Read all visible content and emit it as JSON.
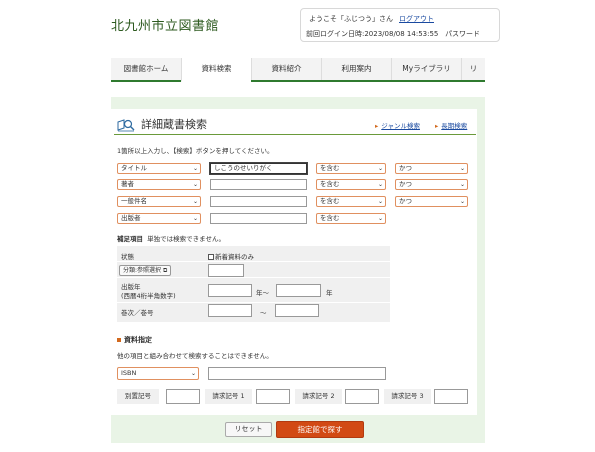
{
  "header": {
    "site_title": "北九州市立図書館",
    "welcome": "ようこそ「ふじつう」さん",
    "logout": "ログアウト",
    "last_login": "前回ログイン日時:2023/08/08 14:53:55",
    "password": "パスワード"
  },
  "tabs": [
    "図書館ホーム",
    "資料検索",
    "資料紹介",
    "利用案内",
    "Myライブラリ",
    "リ"
  ],
  "page": {
    "title": "詳細蔵書検索",
    "link_genre": "ジャンル検索",
    "link_longterm": "長期検索",
    "instruction": "1箇所以上入力し、【検索】ボタンを押してください。"
  },
  "search_rows": [
    {
      "field": "タイトル",
      "value": "しこうのせいりがく",
      "match": "を含む",
      "logic": "かつ"
    },
    {
      "field": "著者",
      "value": "",
      "match": "を含む",
      "logic": "かつ"
    },
    {
      "field": "一般件名",
      "value": "",
      "match": "を含む",
      "logic": "かつ"
    },
    {
      "field": "出版者",
      "value": "",
      "match": "を含む",
      "logic": ""
    }
  ],
  "conditions": {
    "heading_bold": "補足項目",
    "heading_note": "単独では検索できません。",
    "status_label": "状態",
    "new_only": "新着資料のみ",
    "classification_button": "分類:参照選択",
    "pub_year_label1": "出版年",
    "pub_year_label2": "(西暦4桁半角数字)",
    "year_from_suffix": "年～",
    "year_to_suffix": "年",
    "volume_label": "巻次／巻号",
    "range_sep": "～"
  },
  "material": {
    "heading": "資料指定",
    "note": "他の項目と組み合わせて検索することはできません。",
    "type": "ISBN",
    "labels": [
      "別置記号",
      "請求記号 1",
      "請求記号 2",
      "請求記号 3"
    ]
  },
  "buttons": {
    "reset": "リセット",
    "search": "指定館で探す"
  }
}
